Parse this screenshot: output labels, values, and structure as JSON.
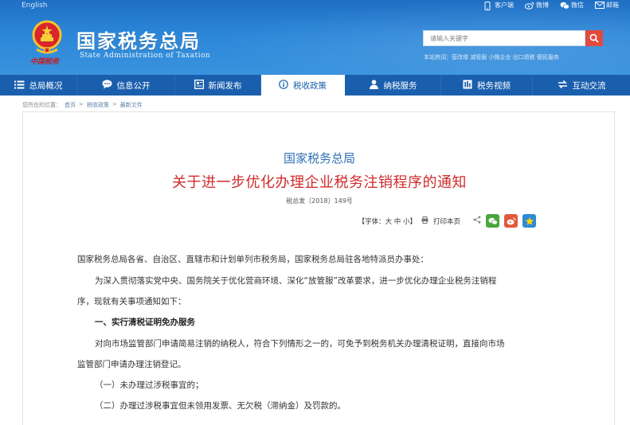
{
  "header": {
    "english_link": "English",
    "top_links": [
      {
        "icon": "phone-icon",
        "label": "客户端"
      },
      {
        "icon": "weibo-icon",
        "label": "微博"
      },
      {
        "icon": "wechat-icon",
        "label": "微信"
      },
      {
        "icon": "mail-icon",
        "label": "邮箱"
      }
    ],
    "site_title": "国家税务总局",
    "site_subtitle": "State Administration of Taxation",
    "logo_text": "中国税务",
    "search_placeholder": "请输入关键字",
    "hot_words": "本站热词：营改增  减管服  小微企业  出口退税  便民服务"
  },
  "nav": {
    "items": [
      {
        "icon": "menu-icon",
        "label": "总局概况",
        "active": false
      },
      {
        "icon": "chat-icon",
        "label": "信息公开",
        "active": false
      },
      {
        "icon": "news-icon",
        "label": "新闻发布",
        "active": false
      },
      {
        "icon": "info-icon",
        "label": "税收政策",
        "active": true
      },
      {
        "icon": "person-icon",
        "label": "纳税服务",
        "active": false
      },
      {
        "icon": "video-icon",
        "label": "税务视频",
        "active": false
      },
      {
        "icon": "exchange-icon",
        "label": "互动交流",
        "active": false
      }
    ]
  },
  "breadcrumb": {
    "prefix": "您所在的位置：",
    "items": [
      "首页",
      "税收政策",
      "最新文件"
    ],
    "separator": ">"
  },
  "article": {
    "agency": "国家税务总局",
    "title": "关于进一步优化办理企业税务注销程序的通知",
    "doc_number": "税总发〔2018〕149号",
    "font_size_label": "【字体：大 中 小】",
    "print_label": "打印本页",
    "paragraphs": [
      "国家税务总局各省、自治区、直辖市和计划单列市税务局，国家税务总局驻各地特派员办事处：",
      "为深入贯彻落实党中央、国务院关于优化营商环境、深化“放管服”改革要求，进一步优化办理企业税务注销程",
      "序，现就有关事项通知如下：",
      "一、实行清税证明免办服务",
      "对向市场监管部门申请简易注销的纳税人，符合下列情形之一的，可免予到税务机关办理清税证明，直接向市场",
      "监管部门申请办理注销登记。",
      "（一）未办理过涉税事宜的；",
      "（二）办理过涉税事宜但未领用发票、无欠税（滞纳金）及罚款的。"
    ]
  },
  "colors": {
    "header_blue": "#2c86d8",
    "nav_blue": "#1a5fad",
    "title_red": "#d02b2b",
    "agency_blue": "#2e6fb3",
    "search_red": "#e03a2f"
  }
}
